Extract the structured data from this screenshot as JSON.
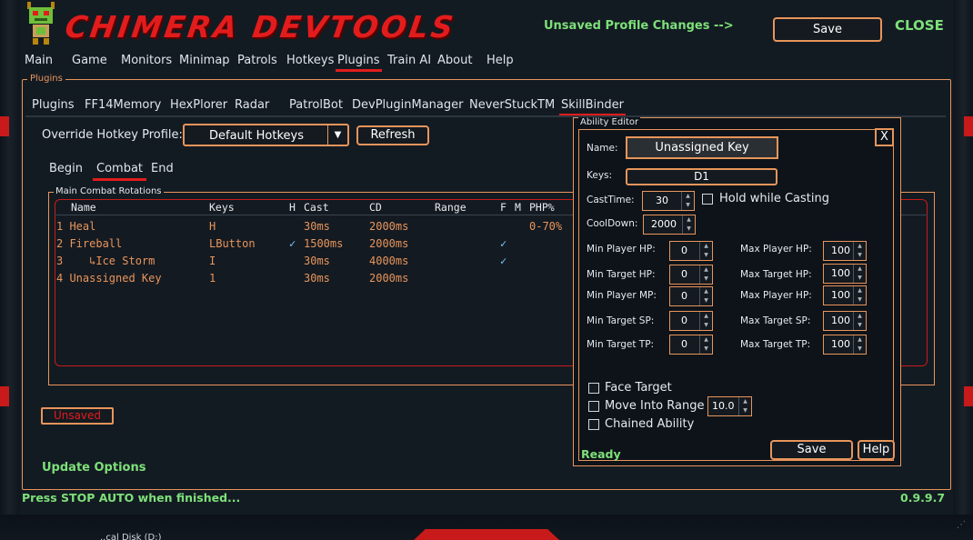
{
  "header": {
    "logo_text": "CHIMERA DEVTOOLS",
    "unsaved_changes": "Unsaved Profile Changes -->",
    "save_label": "Save",
    "close_label": "CLOSE"
  },
  "main_nav": {
    "items": [
      "Main",
      "Game",
      "Monitors",
      "Minimap",
      "Patrols",
      "Hotkeys",
      "Plugins",
      "Train AI",
      "About",
      "Help"
    ],
    "active": "Plugins"
  },
  "plugins": {
    "legend": "Plugins",
    "tabs": [
      "Plugins",
      "FF14Memory",
      "HexPlorer",
      "Radar",
      "PatrolBot",
      "DevPluginManager",
      "NeverStuckTM",
      "SkillBinder"
    ],
    "active_tab": "SkillBinder",
    "override_label": "Override Hotkey Profile:",
    "profile_value": "Default Hotkeys",
    "refresh_label": "Refresh"
  },
  "combat_tabs": {
    "items": [
      "Begin",
      "Combat",
      "End"
    ],
    "active": "Combat"
  },
  "rotations": {
    "legend": "Main Combat Rotations",
    "columns": [
      "Name",
      "Keys",
      "H",
      "Cast",
      "CD",
      "Range",
      "F",
      "M",
      "PHP%"
    ],
    "rows": [
      {
        "name": "1 Heal",
        "keys": "H",
        "h": "",
        "cast": "30ms",
        "cd": "2000ms",
        "range": "",
        "f": "",
        "m": "",
        "php": "0-70%"
      },
      {
        "name": "2 Fireball",
        "keys": "LButton",
        "h": "✓",
        "cast": "1500ms",
        "cd": "2000ms",
        "range": "",
        "f": "✓",
        "m": "",
        "php": ""
      },
      {
        "name": "3    ↳Ice Storm",
        "keys": "I",
        "h": "",
        "cast": "30ms",
        "cd": "4000ms",
        "range": "",
        "f": "✓",
        "m": "",
        "php": ""
      },
      {
        "name": "4 Unassigned Key",
        "keys": "1",
        "h": "",
        "cast": "30ms",
        "cd": "2000ms",
        "range": "",
        "f": "",
        "m": "",
        "php": ""
      }
    ]
  },
  "unsaved_badge": "Unsaved",
  "update_options": "Update Options",
  "status_bar": {
    "left": "Press STOP AUTO when finished...",
    "version": "0.9.9.7"
  },
  "ability_editor": {
    "legend": "Ability Editor",
    "close_label": "X",
    "name_label": "Name:",
    "name_value": "Unassigned Key",
    "keys_label": "Keys:",
    "keys_value": "D1",
    "casttime_label": "CastTime:",
    "casttime_value": "30",
    "hold_label": "Hold while Casting",
    "cooldown_label": "CoolDown:",
    "cooldown_value": "2000",
    "left_fields": [
      {
        "label": "Min Player HP:",
        "value": "0"
      },
      {
        "label": "Min Target HP:",
        "value": "0"
      },
      {
        "label": "Min Player MP:",
        "value": "0"
      },
      {
        "label": "Min Target SP:",
        "value": "0"
      },
      {
        "label": "Min Target TP:",
        "value": "0"
      }
    ],
    "right_fields": [
      {
        "label": "Max Player HP:",
        "value": "100"
      },
      {
        "label": "Max Target HP:",
        "value": "100"
      },
      {
        "label": "Max Player HP:",
        "value": "100"
      },
      {
        "label": "Max Target SP:",
        "value": "100"
      },
      {
        "label": "Max Target TP:",
        "value": "100"
      }
    ],
    "face_target_label": "Face Target",
    "move_range_label": "Move Into Range",
    "move_range_value": "10.0",
    "chained_label": "Chained Ability",
    "status": "Ready",
    "save_label": "Save",
    "help_label": "Help"
  },
  "taskbar_text": "..cal Disk (D:)",
  "colors": {
    "accent_orange": "#e8955c",
    "brand_red": "#e21c1c",
    "status_green": "#7ee07a",
    "check_blue": "#7ac8ff"
  }
}
